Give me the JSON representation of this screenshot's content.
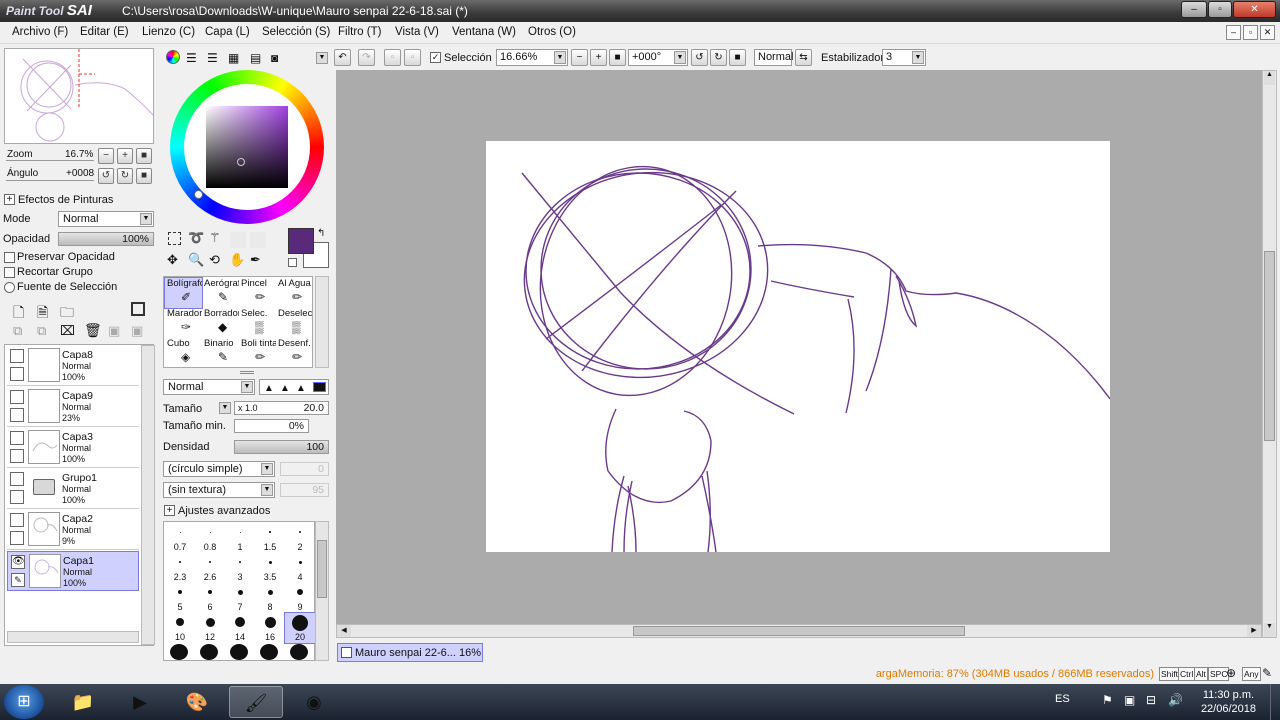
{
  "window": {
    "logo_small": "Paint Tool",
    "logo_big": "SAI",
    "title": "C:\\Users\\rosa\\Downloads\\W-unique\\Mauro senpai 22-6-18.sai (*)"
  },
  "menu": [
    "Archivo (F)",
    "Editar (E)",
    "Lienzo (C)",
    "Capa (L)",
    "Selección (S)",
    "Filtro (T)",
    "Vista (V)",
    "Ventana (W)",
    "Otros (O)"
  ],
  "navigator": {
    "zoom_label": "Zoom",
    "zoom_value": "16.7%",
    "angle_label": "Ángulo",
    "angle_value": "+0008"
  },
  "layer_panel": {
    "effects_label": "Efectos de Pinturas",
    "mode_label": "Mode",
    "mode_value": "Normal",
    "opacity_label": "Opacidad",
    "opacity_value": "100%",
    "preserve_opacity": "Preservar Opacidad",
    "clip_group": "Recortar Grupo",
    "selection_source": "Fuente de Selección",
    "layers": [
      {
        "name": "Capa8",
        "mode": "Normal",
        "opacity": "100%",
        "selected": false
      },
      {
        "name": "Capa9",
        "mode": "Normal",
        "opacity": "23%",
        "selected": false
      },
      {
        "name": "Capa3",
        "mode": "Normal",
        "opacity": "100%",
        "selected": false
      },
      {
        "name": "Grupo1",
        "mode": "Normal",
        "opacity": "100%",
        "selected": false
      },
      {
        "name": "Capa2",
        "mode": "Normal",
        "opacity": "9%",
        "selected": false
      },
      {
        "name": "Capa1",
        "mode": "Normal",
        "opacity": "100%",
        "selected": true
      }
    ]
  },
  "colors": {
    "primary": "#5a2a7a",
    "secondary": "#ffffff",
    "stroke": "#6a3a8a",
    "accent_selected": "#d0d0ff",
    "memory_text": "#e07a00"
  },
  "tools": [
    {
      "label": "Bolígrafo",
      "icon": "pen-icon",
      "selected": true
    },
    {
      "label": "Aerógrafo",
      "icon": "airbrush-icon",
      "selected": false
    },
    {
      "label": "Pincel",
      "icon": "brush-icon",
      "selected": false
    },
    {
      "label": "Al Agua",
      "icon": "water-icon",
      "selected": false
    },
    {
      "label": "Marador",
      "icon": "marker-icon",
      "selected": false
    },
    {
      "label": "Borrador",
      "icon": "eraser-icon",
      "selected": false
    },
    {
      "label": "Selec.",
      "icon": "select-icon",
      "selected": false
    },
    {
      "label": "Deselec.",
      "icon": "deselect-icon",
      "selected": false
    },
    {
      "label": "Cubo",
      "icon": "bucket-icon",
      "selected": false
    },
    {
      "label": "Binario",
      "icon": "binary-icon",
      "selected": false
    },
    {
      "label": "Boli tinta",
      "icon": "ink-pen-icon",
      "selected": false
    },
    {
      "label": "Desenf.",
      "icon": "blur-icon",
      "selected": false
    }
  ],
  "brush": {
    "mode": "Normal",
    "size_label": "Tamaño",
    "size_multiplier": "x 1.0",
    "size_value": "20.0",
    "min_size_label": "Tamaño min.",
    "min_size_value": "0%",
    "density_label": "Densidad",
    "density_value": "100",
    "shape": "(círculo simple)",
    "shape_value": "0",
    "texture": "(sin textura)",
    "texture_value": "95",
    "advanced_label": "Ajustes avanzados",
    "sizes": [
      "0.7",
      "0.8",
      "1",
      "1.5",
      "2",
      "2.3",
      "2.6",
      "3",
      "3.5",
      "4",
      "5",
      "6",
      "7",
      "8",
      "9",
      "10",
      "12",
      "14",
      "16",
      "20"
    ],
    "selected_size": "20"
  },
  "toolbar": {
    "selection_label": "Selección",
    "zoom": "16.66%",
    "angle": "+000°",
    "blend": "Normal",
    "stabilizer_label": "Estabilizador",
    "stabilizer_value": "3"
  },
  "document_tab": {
    "name": "Mauro senpai 22-6...",
    "zoom": "16%"
  },
  "status": {
    "memory": "argaMemoria: 87% (304MB usados / 866MB reservados)",
    "keys": [
      "Shift",
      "Ctrl",
      "Alt",
      "SPC",
      "Any"
    ]
  },
  "taskbar": {
    "lang": "ES",
    "time": "11:30 p.m.",
    "date": "22/06/2018"
  }
}
